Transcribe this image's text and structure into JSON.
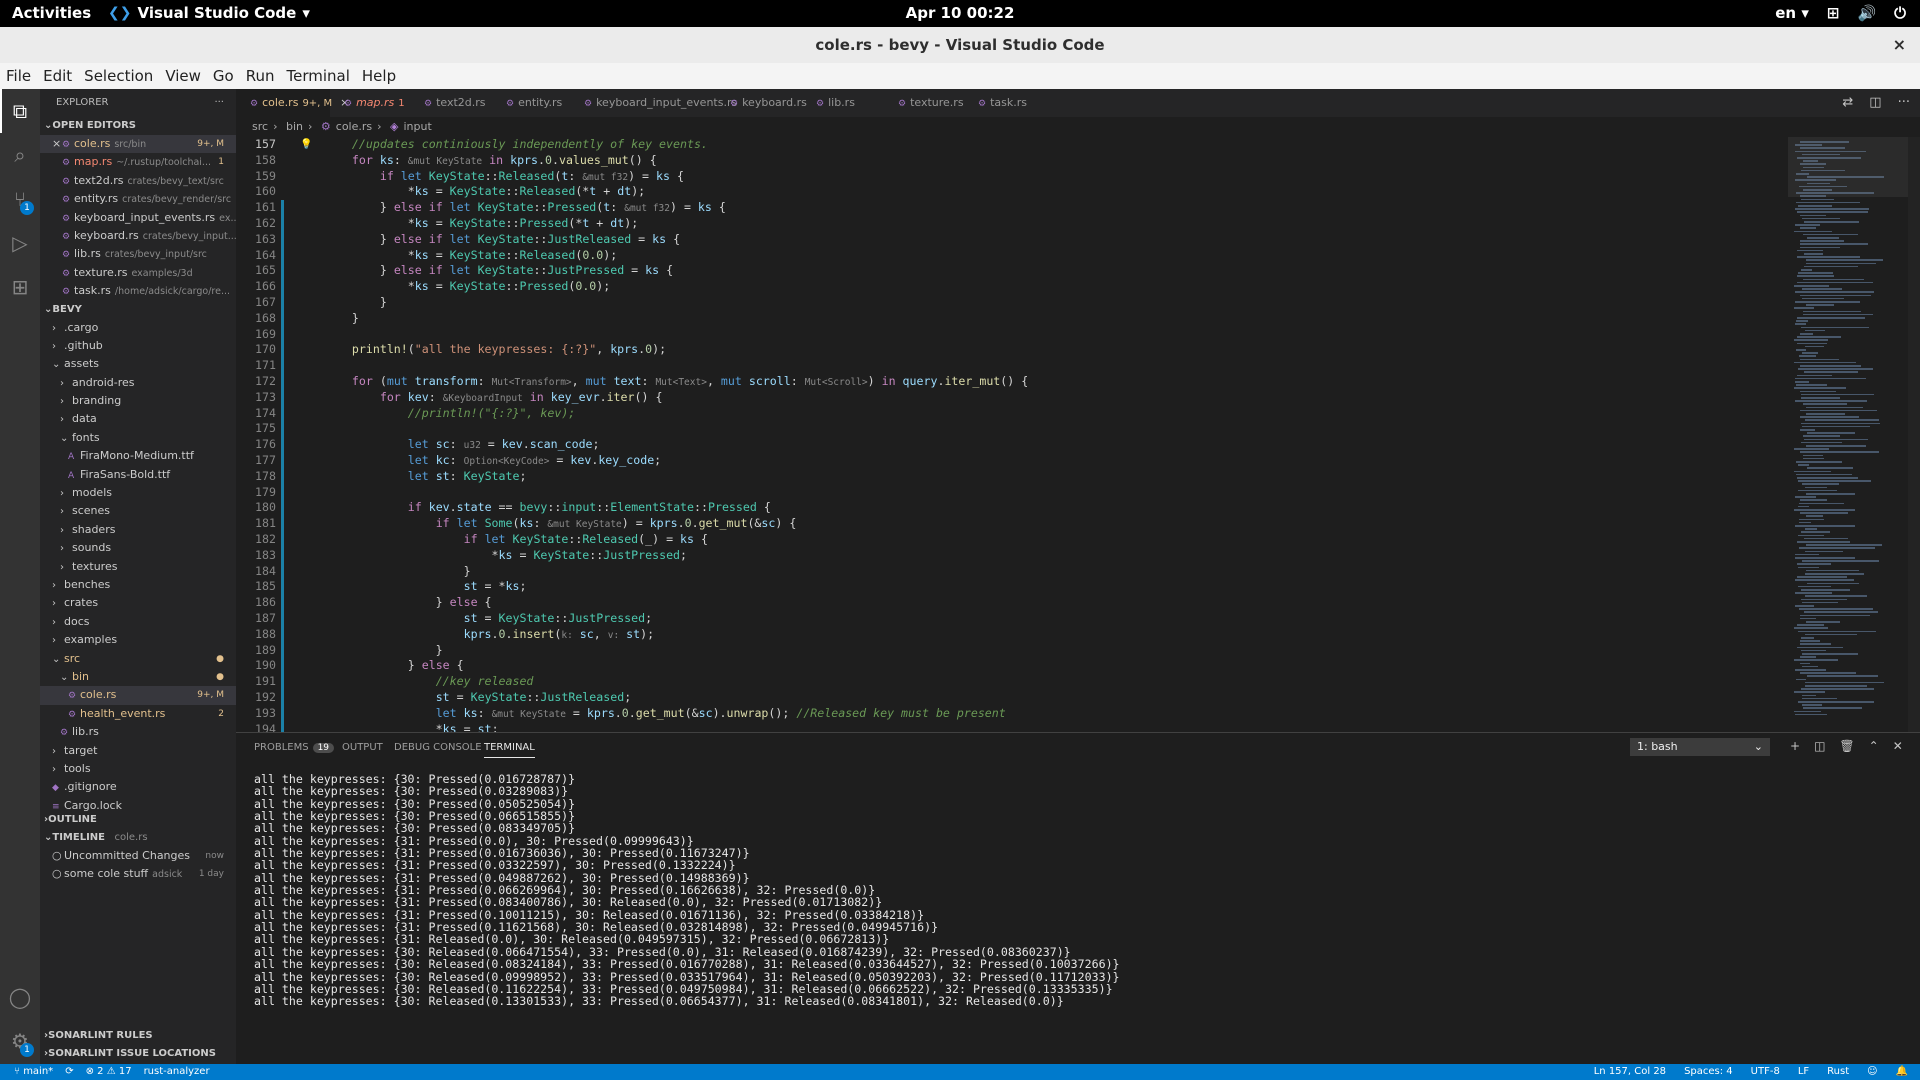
{
  "gnome": {
    "activities": "Activities",
    "app": "Visual Studio Code",
    "app_caret": "▾",
    "clock": "Apr 10  00:22",
    "lang": "en",
    "lang_caret": "▾",
    "network_icon": "network-icon",
    "volume_icon": "volume-icon",
    "power_icon": "power-icon"
  },
  "window": {
    "title": "cole.rs - bevy - Visual Studio Code",
    "close": "×"
  },
  "menu": [
    "File",
    "Edit",
    "Selection",
    "View",
    "Go",
    "Run",
    "Terminal",
    "Help"
  ],
  "activity": {
    "scm_badge": "1",
    "debug_badge": "1"
  },
  "sidebar": {
    "title": "EXPLORER",
    "more": "···",
    "open_editors": {
      "label": "OPEN EDITORS",
      "items": [
        {
          "name": "cole.rs",
          "desc": "src/bin",
          "stat": "9+, M"
        },
        {
          "name": "map.rs",
          "desc": "~/.rustup/toolchai...",
          "stat": "1"
        },
        {
          "name": "text2d.rs",
          "desc": "crates/bevy_text/src",
          "stat": ""
        },
        {
          "name": "entity.rs",
          "desc": "crates/bevy_render/src",
          "stat": ""
        },
        {
          "name": "keyboard_input_events.rs",
          "desc": "ex...",
          "stat": ""
        },
        {
          "name": "keyboard.rs",
          "desc": "crates/bevy_input...",
          "stat": ""
        },
        {
          "name": "lib.rs",
          "desc": "crates/bevy_input/src",
          "stat": ""
        },
        {
          "name": "texture.rs",
          "desc": "examples/3d",
          "stat": ""
        },
        {
          "name": "task.rs",
          "desc": "/home/adsick/cargo/re...",
          "stat": ""
        }
      ]
    },
    "project": {
      "label": "BEVY",
      "items": [
        {
          "name": ".cargo",
          "stat": ""
        },
        {
          "name": ".github",
          "stat": ""
        },
        {
          "name": "assets",
          "stat": ""
        },
        {
          "name": "android-res",
          "stat": ""
        },
        {
          "name": "branding",
          "stat": ""
        },
        {
          "name": "data",
          "stat": ""
        },
        {
          "name": "fonts",
          "stat": ""
        },
        {
          "name": "FiraMono-Medium.ttf",
          "stat": ""
        },
        {
          "name": "FiraSans-Bold.ttf",
          "stat": ""
        },
        {
          "name": "models",
          "stat": ""
        },
        {
          "name": "scenes",
          "stat": ""
        },
        {
          "name": "shaders",
          "stat": ""
        },
        {
          "name": "sounds",
          "stat": ""
        },
        {
          "name": "textures",
          "stat": ""
        },
        {
          "name": "benches",
          "stat": ""
        },
        {
          "name": "crates",
          "stat": ""
        },
        {
          "name": "docs",
          "stat": ""
        },
        {
          "name": "examples",
          "stat": ""
        },
        {
          "name": "src",
          "stat": "●"
        },
        {
          "name": "bin",
          "stat": "●"
        },
        {
          "name": "cole.rs",
          "stat": "9+, M"
        },
        {
          "name": "health_event.rs",
          "stat": "2"
        },
        {
          "name": "lib.rs",
          "stat": ""
        },
        {
          "name": "target",
          "stat": ""
        },
        {
          "name": "tools",
          "stat": ""
        },
        {
          "name": ".gitignore",
          "stat": ""
        },
        {
          "name": "Cargo.lock",
          "stat": ""
        }
      ]
    },
    "outline": "OUTLINE",
    "timeline": {
      "label": "TIMELINE",
      "file": "cole.rs",
      "items": [
        {
          "name": "Uncommitted Changes",
          "desc": "",
          "time": "now"
        },
        {
          "name": "some cole stuff",
          "desc": "adsick",
          "time": "1 day"
        }
      ]
    },
    "sonarlint_rules": "SONARLINT RULES",
    "sonarlint_issues": "SONARLINT ISSUE LOCATIONS"
  },
  "tabs": [
    {
      "label": "cole.rs",
      "stat": "9+, M",
      "close": "×"
    },
    {
      "label": "map.rs",
      "stat": "1"
    },
    {
      "label": "text2d.rs"
    },
    {
      "label": "entity.rs"
    },
    {
      "label": "keyboard_input_events.rs"
    },
    {
      "label": "keyboard.rs"
    },
    {
      "label": "lib.rs"
    },
    {
      "label": "texture.rs"
    },
    {
      "label": "task.rs"
    }
  ],
  "breadcrumb": [
    "src",
    "bin",
    "cole.rs",
    "input"
  ],
  "editor": {
    "line_numbers": [
      "157",
      "158",
      "159",
      "160",
      "161",
      "162",
      "163",
      "164",
      "165",
      "166",
      "167",
      "168",
      "169",
      "170",
      "171",
      "172",
      "173",
      "174",
      "175",
      "176",
      "177",
      "178",
      "179",
      "180",
      "181",
      "182",
      "183",
      "184",
      "185",
      "186",
      "187",
      "188",
      "189",
      "190",
      "191",
      "192",
      "193",
      "194"
    ]
  },
  "panel": {
    "tabs": [
      {
        "label": "PROBLEMS",
        "badge": "19"
      },
      {
        "label": "OUTPUT"
      },
      {
        "label": "DEBUG CONSOLE"
      },
      {
        "label": "TERMINAL"
      }
    ],
    "terminal_select": "1: bash",
    "terminal_lines": [
      "all the keypresses: {30: Pressed(0.016728787)}",
      "all the keypresses: {30: Pressed(0.03289083)}",
      "all the keypresses: {30: Pressed(0.050525054)}",
      "all the keypresses: {30: Pressed(0.066515855)}",
      "all the keypresses: {30: Pressed(0.083349705)}",
      "all the keypresses: {31: Pressed(0.0), 30: Pressed(0.09999643)}",
      "all the keypresses: {31: Pressed(0.016736036), 30: Pressed(0.11673247)}",
      "all the keypresses: {31: Pressed(0.03322597), 30: Pressed(0.1332224)}",
      "all the keypresses: {31: Pressed(0.049887262), 30: Pressed(0.14988369)}",
      "all the keypresses: {31: Pressed(0.066269964), 30: Pressed(0.16626638), 32: Pressed(0.0)}",
      "all the keypresses: {31: Pressed(0.083400786), 30: Released(0.0), 32: Pressed(0.01713082)}",
      "all the keypresses: {31: Pressed(0.10011215), 30: Released(0.01671136), 32: Pressed(0.03384218)}",
      "all the keypresses: {31: Pressed(0.11621568), 30: Released(0.032814898), 32: Pressed(0.049945716)}",
      "all the keypresses: {31: Released(0.0), 30: Released(0.049597315), 32: Pressed(0.06672813)}",
      "all the keypresses: {30: Released(0.066471554), 33: Pressed(0.0), 31: Released(0.016874239), 32: Pressed(0.08360237)}",
      "all the keypresses: {30: Released(0.08324184), 33: Pressed(0.016770288), 31: Released(0.033644527), 32: Pressed(0.10037266)}",
      "all the keypresses: {30: Released(0.09998952), 33: Pressed(0.033517964), 31: Released(0.050392203), 32: Pressed(0.11712033)}",
      "all the keypresses: {30: Released(0.11622254), 33: Pressed(0.049750984), 31: Released(0.06662522), 32: Pressed(0.13335335)}",
      "all the keypresses: {30: Released(0.13301533), 33: Pressed(0.06654377), 31: Released(0.08341801), 32: Released(0.0)}"
    ]
  },
  "status": {
    "branch": "main*",
    "sync": "⟳",
    "errors": "⊗ 2",
    "warnings": "⚠ 17",
    "analyzer": "rust-analyzer",
    "position": "Ln 157, Col 28",
    "spaces": "Spaces: 4",
    "encoding": "UTF-8",
    "eol": "LF",
    "language": "Rust"
  }
}
